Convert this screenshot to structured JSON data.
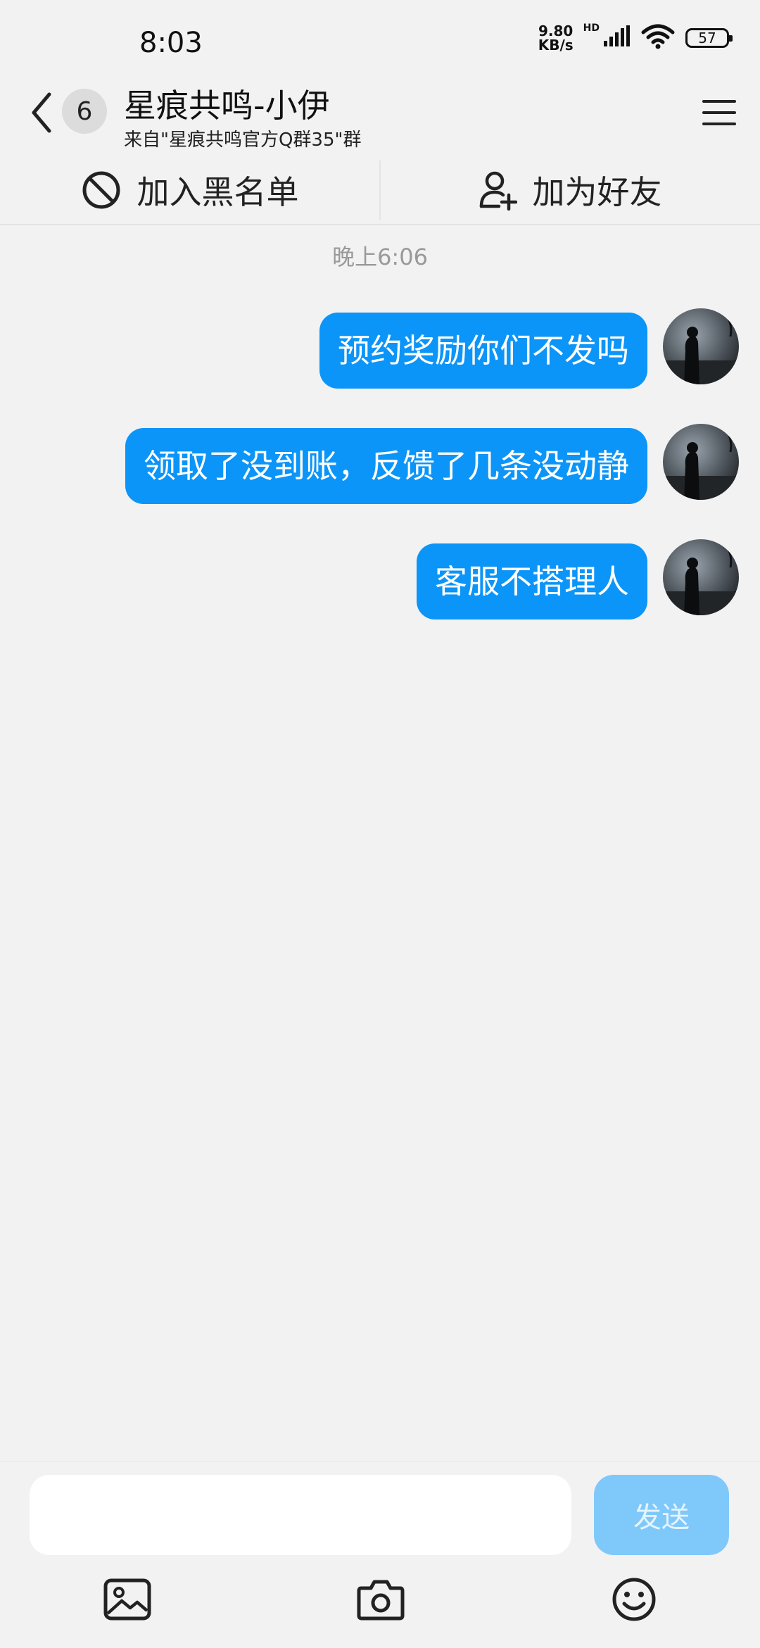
{
  "status_bar": {
    "time": "8:03",
    "net_speed_value": "9.80",
    "net_speed_unit": "KB/s",
    "hd_label": "HD",
    "battery_level": "57",
    "icons": [
      "signal-icon",
      "wifi-icon",
      "battery-icon"
    ]
  },
  "header": {
    "unread_count": "6",
    "title": "星痕共鸣-小伊",
    "subtitle": "来自\"星痕共鸣官方Q群35\"群",
    "icons": [
      "back-arrow-icon",
      "menu-icon"
    ]
  },
  "actions": {
    "blacklist_label": "加入黑名单",
    "add_friend_label": "加为好友",
    "icons": [
      "block-icon",
      "add-user-icon"
    ]
  },
  "chat": {
    "timestamp": "晚上6:06",
    "messages": [
      {
        "text": "预约奖励你们不发吗",
        "sender": "self"
      },
      {
        "text": "领取了没到账，反馈了几条没动静",
        "sender": "self"
      },
      {
        "text": "客服不搭理人",
        "sender": "self"
      }
    ]
  },
  "composer": {
    "input_value": "",
    "send_label": "发送",
    "tools": [
      "image-icon",
      "camera-icon",
      "emoji-icon"
    ]
  },
  "colors": {
    "bubble": "#0c95f8",
    "send_button": "#7fc8fa",
    "background": "#f2f2f2"
  }
}
